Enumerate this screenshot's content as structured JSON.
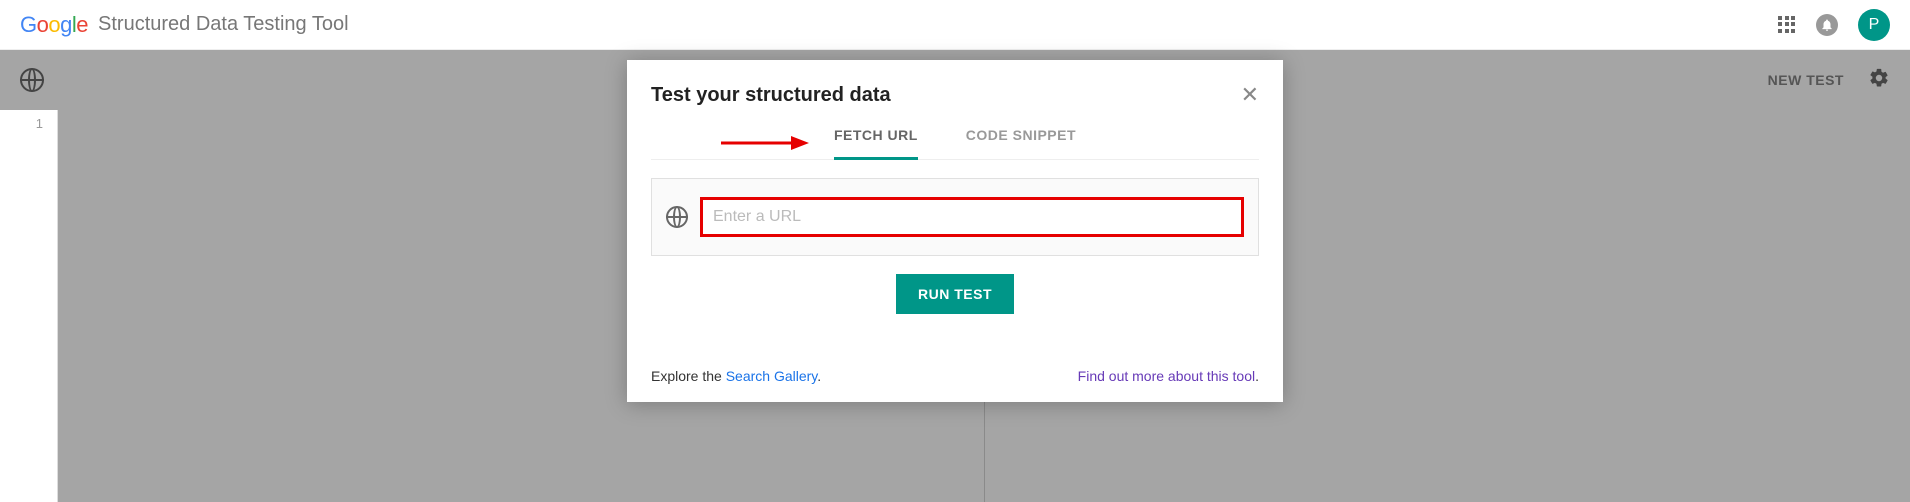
{
  "header": {
    "logo_text": "Google",
    "app_title": "Structured Data Testing Tool",
    "avatar_initial": "P"
  },
  "toolbar": {
    "new_test_label": "NEW TEST"
  },
  "editor": {
    "line_number": "1"
  },
  "modal": {
    "title": "Test your structured data",
    "tabs": {
      "fetch_url": "FETCH URL",
      "code_snippet": "CODE SNIPPET"
    },
    "url_input_placeholder": "Enter a URL",
    "run_button": "RUN TEST",
    "footer": {
      "explore_prefix": "Explore the ",
      "explore_link": "Search Gallery",
      "explore_suffix": ".",
      "more_link": "Find out more about this tool",
      "more_suffix": "."
    }
  },
  "colors": {
    "accent": "#009688",
    "annotation_red": "#e60000",
    "link_blue": "#1a73e8",
    "link_purple": "#673ab7"
  }
}
